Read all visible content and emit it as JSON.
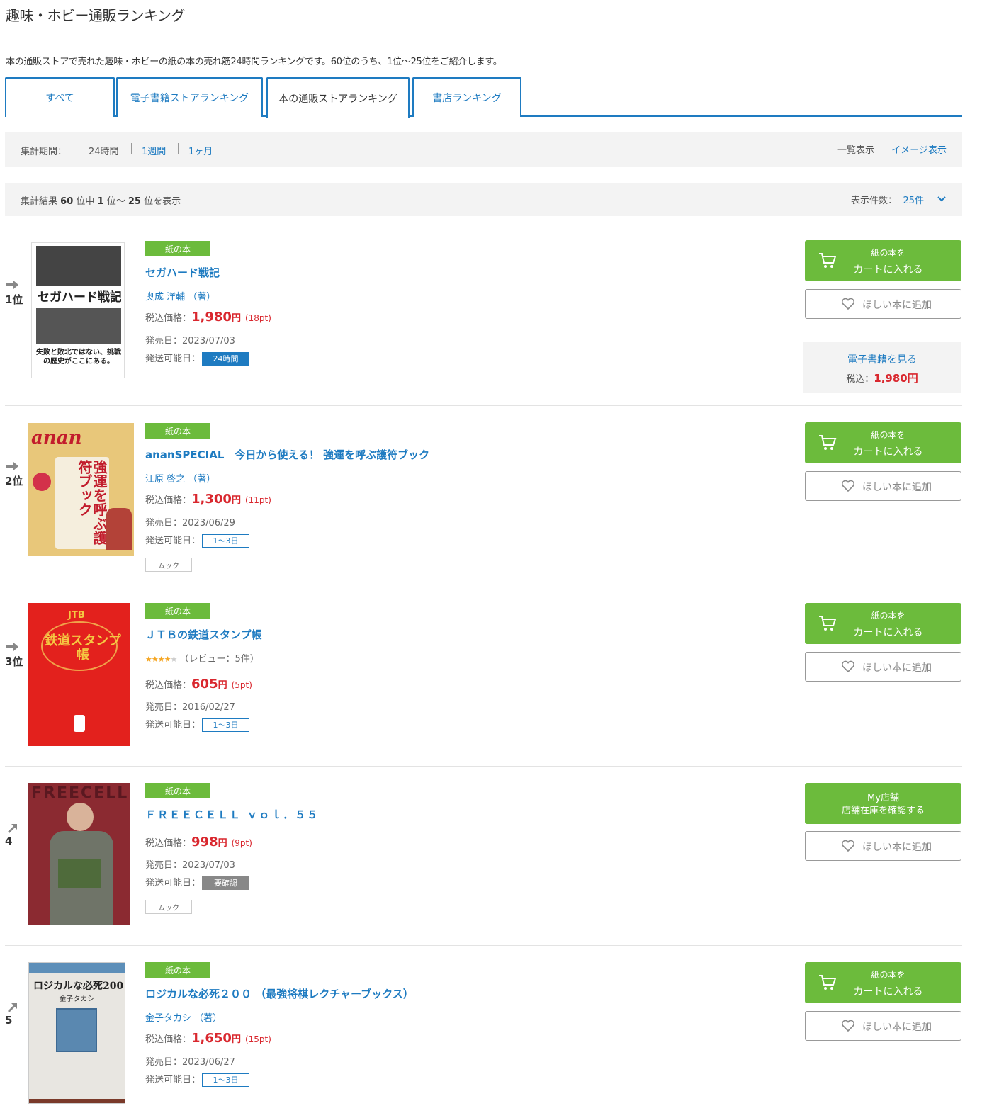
{
  "page": {
    "title": "趣味・ホビー通販ランキング",
    "description": "本の通販ストアで売れた趣味・ホビーの紙の本の売れ筋24時間ランキングです。60位のうち、1位～25位をご紹介します。"
  },
  "tabs": [
    {
      "label": "すべて"
    },
    {
      "label": "電子書籍ストアランキング"
    },
    {
      "label": "本の通販ストアランキング",
      "active": true
    },
    {
      "label": "書店ランキング"
    }
  ],
  "period": {
    "label": "集計期間：",
    "options": [
      "24時間",
      "1週間",
      "1ヶ月"
    ],
    "selected": "24時間",
    "view_list": "一覧表示",
    "view_image": "イメージ表示"
  },
  "results": {
    "prefix": "集計結果",
    "total": "60",
    "mid1": "位中",
    "from": "1",
    "mid2": "位～",
    "to": "25",
    "suffix": "位を表示",
    "count_label": "表示件数：",
    "count_value": "25件"
  },
  "labels": {
    "paper_badge": "紙の本",
    "price_label": "税込価格：",
    "yen": "円",
    "release_label": "発売日：",
    "ship_label": "発送可能日：",
    "cart_l1": "紙の本を",
    "cart_l2": "カートに入れる",
    "wish": "ほしい本に追加",
    "store_l1": "My店舗",
    "store_l2": "店舗在庫を確認する",
    "ebook_link": "電子書籍を見る",
    "ebook_price_label": "税込：",
    "ebook_price": "1,980円"
  },
  "items": [
    {
      "rank": "1位",
      "title": "セガハード戦記",
      "author": "奥成 洋輔 （著）",
      "price": "1,980",
      "points": "(18pt)",
      "release": "2023/07/03",
      "ship": "24時間",
      "ship_style": "blue"
    },
    {
      "rank": "2位",
      "title": "ananSPECIAL　今日から使える！ 強運を呼ぶ護符ブック",
      "author": "江原 啓之 （著）",
      "price": "1,300",
      "points": "(11pt)",
      "release": "2023/06/29",
      "ship": "1～3日",
      "ship_style": "outline",
      "genre": "ムック"
    },
    {
      "rank": "3位",
      "title": "ＪＴＢの鉄道スタンプ帳",
      "review": "（レビュー：5件）",
      "rating": 4,
      "price": "605",
      "points": "(5pt)",
      "release": "2016/02/27",
      "ship": "1～3日",
      "ship_style": "outline"
    },
    {
      "rank": "4",
      "title": "ＦＲＥＥＣＥＬＬ ｖｏｌ．５５",
      "price": "998",
      "points": "(9pt)",
      "release": "2023/07/03",
      "ship": "要確認",
      "ship_style": "gray",
      "genre": "ムック"
    },
    {
      "rank": "5",
      "title": "ロジカルな必死２００ （最強将棋レクチャーブックス）",
      "author": "金子タカシ （著）",
      "price": "1,650",
      "points": "(15pt)",
      "release": "2023/06/27",
      "ship": "1～3日",
      "ship_style": "outline"
    }
  ],
  "covers": [
    {
      "text": "セガハード戦記",
      "subtext": "失敗と敗北ではない、挑戦の歴史がここにある。"
    },
    {
      "text": "anan",
      "subtext": "強運を呼ぶ護符ブック"
    },
    {
      "text": "鉄道スタンプ帳",
      "subtext": "JTB"
    },
    {
      "text": "FREECELL"
    },
    {
      "text": "ロジカルな必死200",
      "subtext": "金子タカシ"
    }
  ],
  "colors": {
    "accent_blue": "#1e7bc1",
    "green": "#6cbb3c",
    "price_red": "#d9272e"
  }
}
